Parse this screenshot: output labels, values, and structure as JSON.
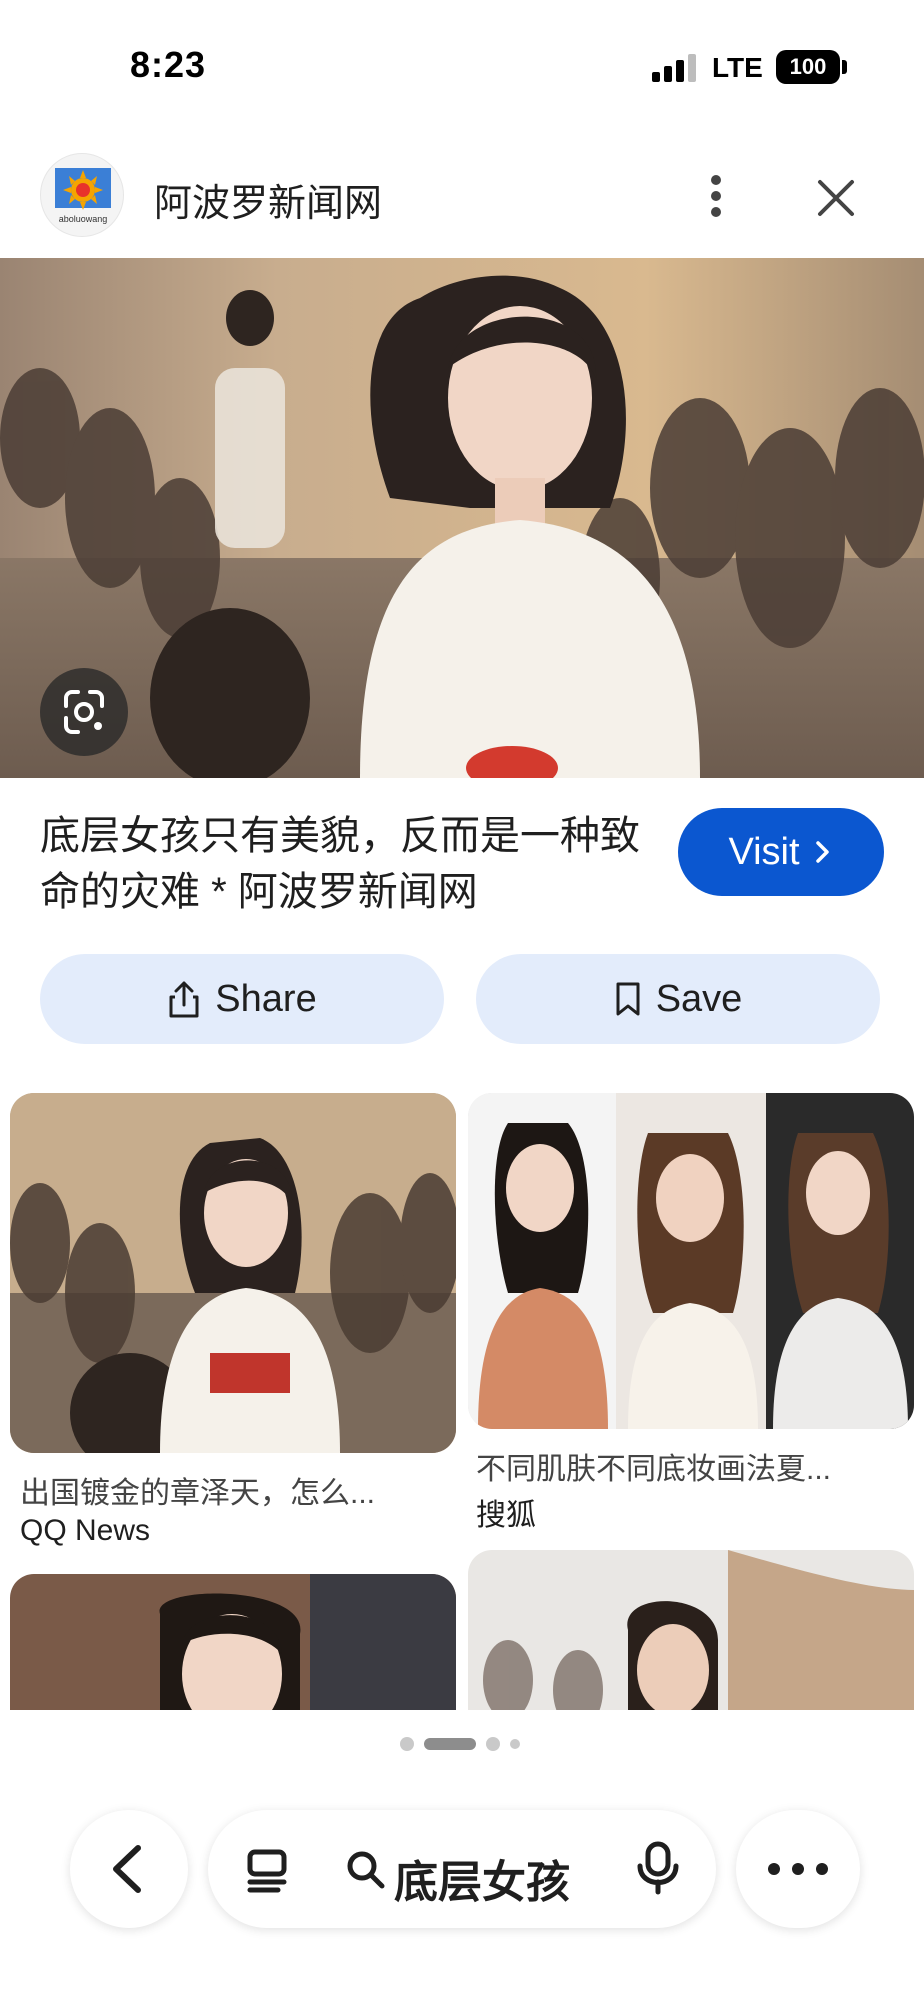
{
  "status_bar": {
    "time": "8:23",
    "network": "LTE",
    "battery": "100"
  },
  "header": {
    "site_name": "阿波罗新闻网",
    "logo_text": "aboluowang"
  },
  "result": {
    "title": "底层女孩只有美貌，反而是一种致命的灾难 * 阿波罗新闻网",
    "visit_label": "Visit",
    "share_label": "Share",
    "save_label": "Save"
  },
  "related": [
    {
      "title": "出国镀金的章泽天，怎么...",
      "source": "QQ News"
    },
    {
      "title": "不同肌肤不同底妆画法夏...",
      "source": "搜狐"
    }
  ],
  "pagination": {
    "total": 4,
    "active": 1
  },
  "bottom_bar": {
    "query": "底层女孩"
  },
  "colors": {
    "accent": "#0b57d0",
    "pill_bg": "#e3ecfb"
  }
}
